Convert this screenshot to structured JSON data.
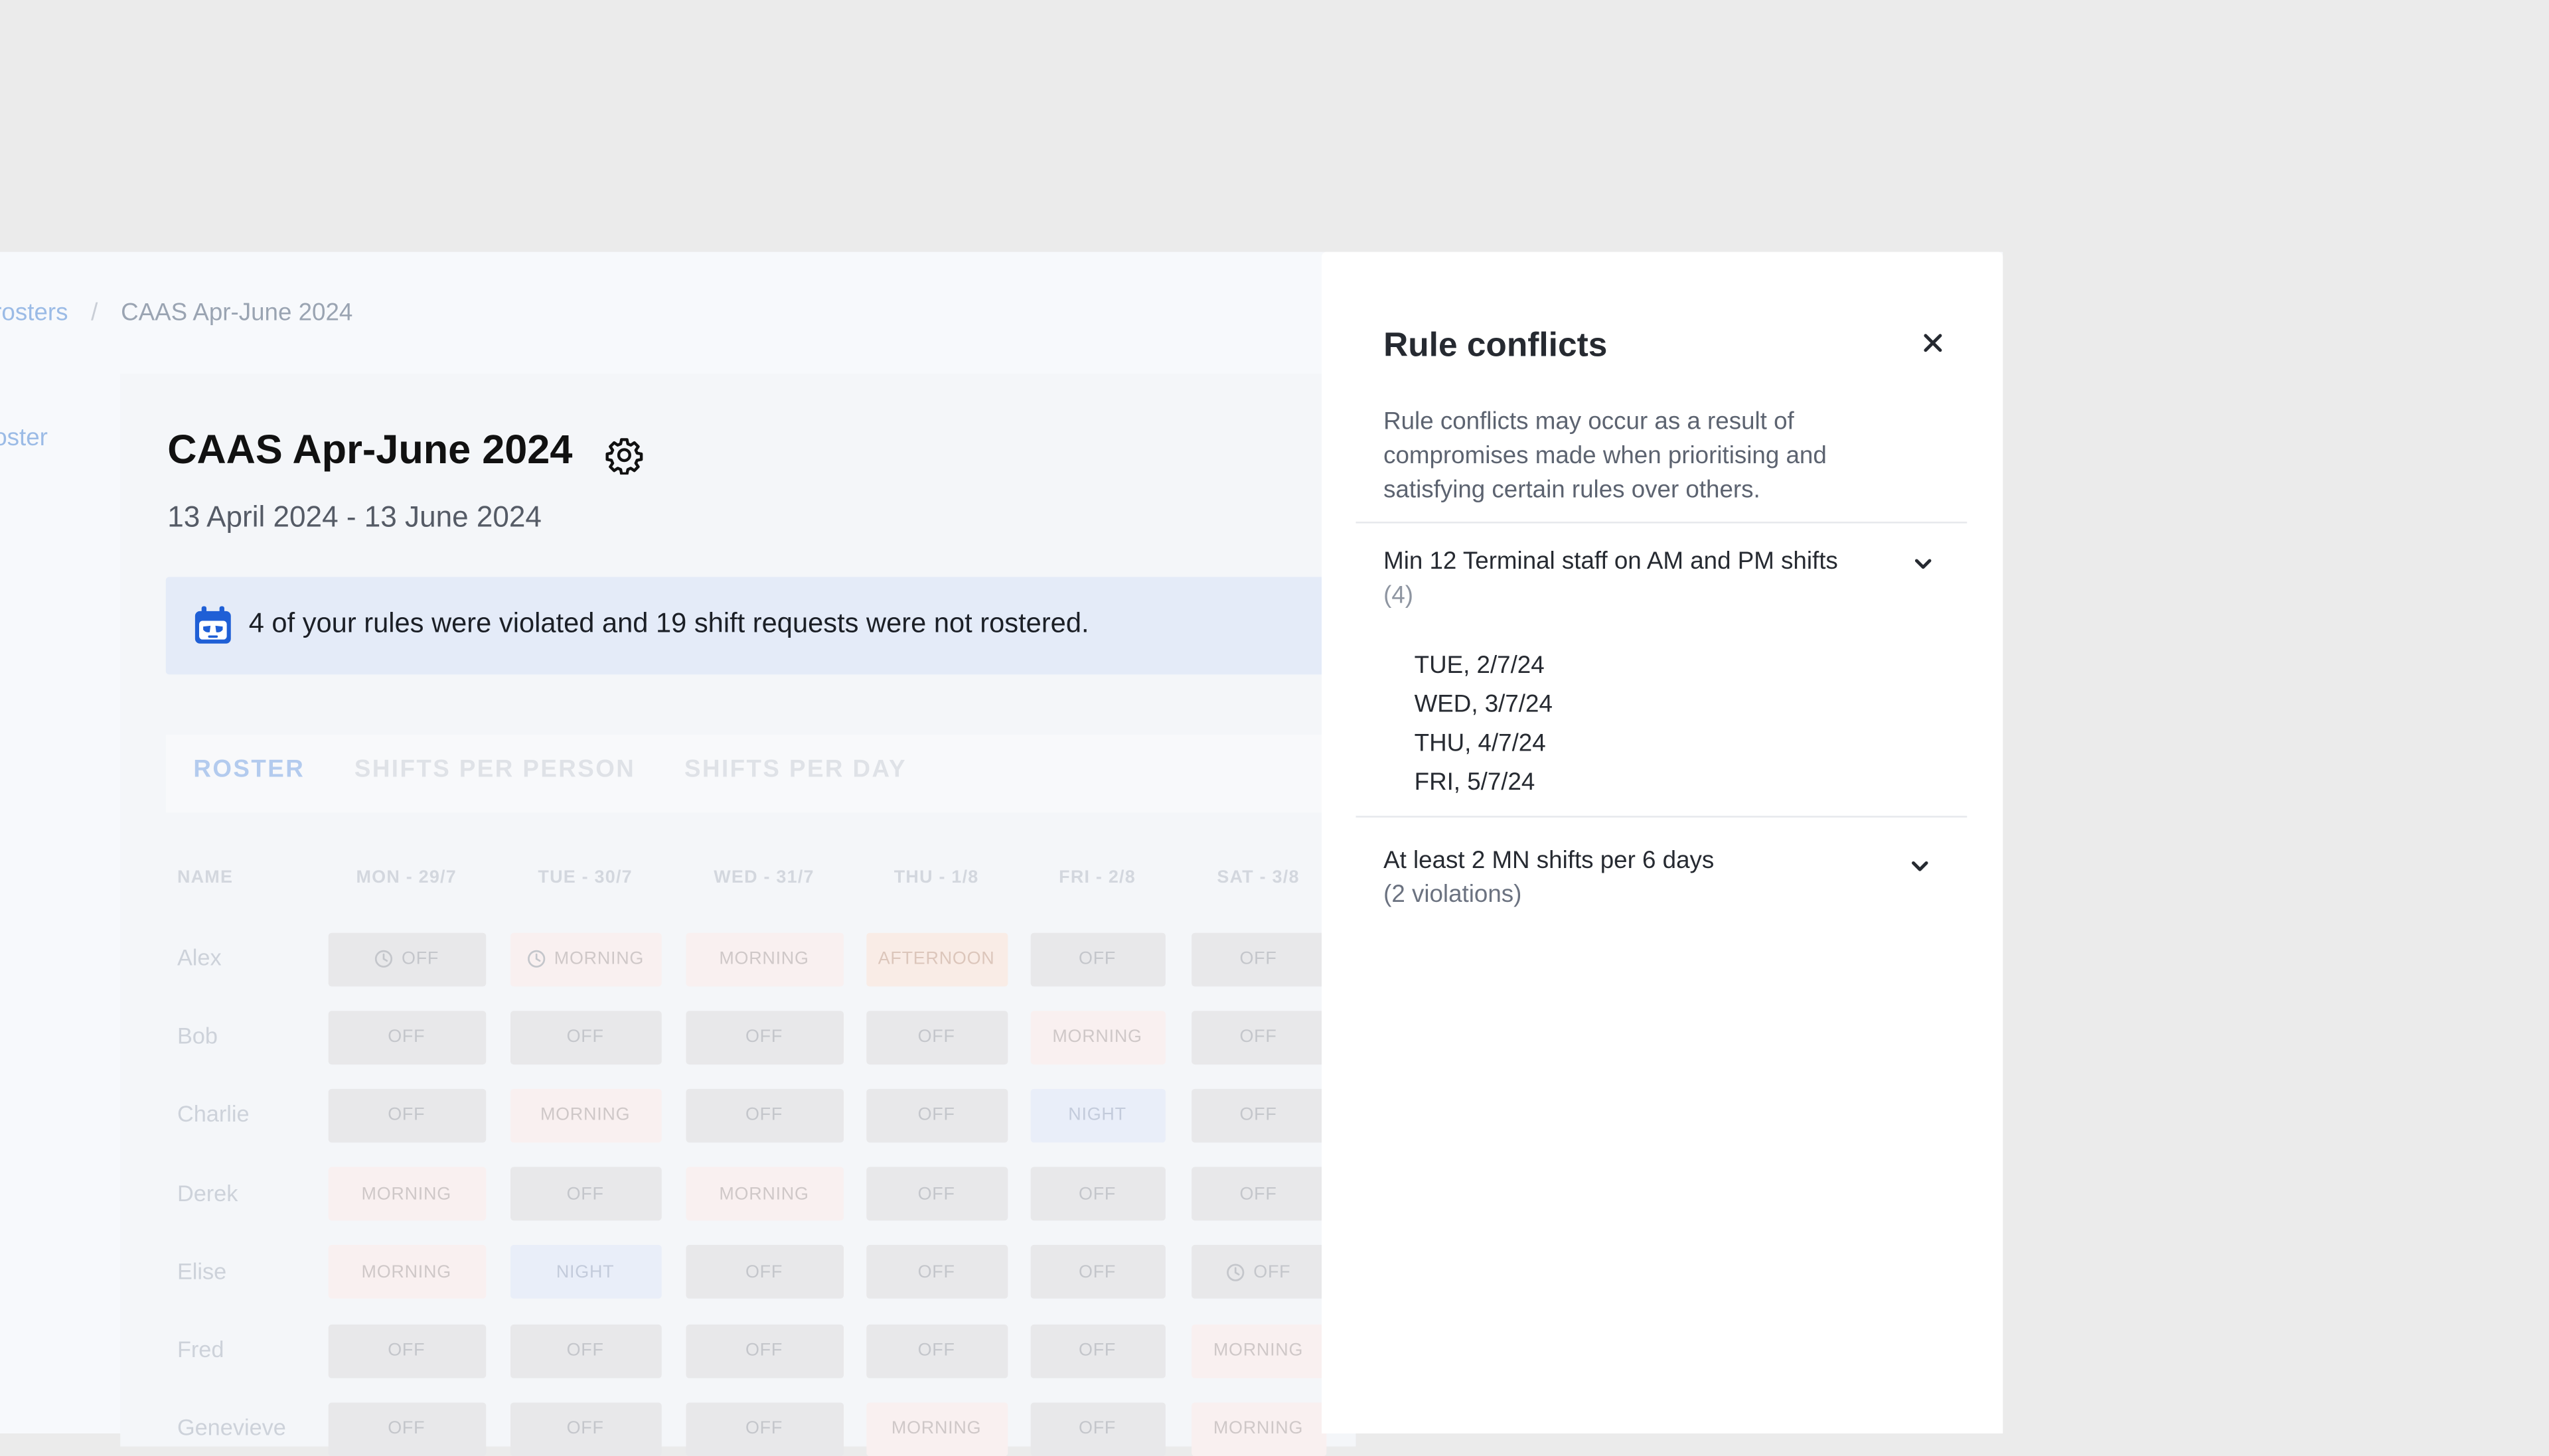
{
  "breadcrumb": {
    "parent": "rosters",
    "current": "CAAS Apr-June 2024"
  },
  "sidebar": {
    "link_label": "oster"
  },
  "roster": {
    "title": "CAAS Apr-June 2024",
    "date_range": "13 April 2024 - 13 June 2024",
    "banner_text": "4 of your rules were violated and 19 shift requests were not rostered."
  },
  "tabs": [
    {
      "label": "ROSTER",
      "active": true
    },
    {
      "label": "SHIFTS PER PERSON",
      "active": false
    },
    {
      "label": "SHIFTS PER DAY",
      "active": false
    }
  ],
  "table": {
    "headers": [
      "NAME",
      "MON - 29/7",
      "TUE - 30/7",
      "WED - 31/7",
      "THU - 1/8",
      "FRI - 2/8",
      "SAT - 3/8"
    ],
    "rows": [
      {
        "name": "Alex",
        "cells": [
          {
            "label": "OFF",
            "type": "off",
            "clock": true
          },
          {
            "label": "MORNING",
            "type": "morning",
            "clock": true
          },
          {
            "label": "MORNING",
            "type": "morning"
          },
          {
            "label": "AFTERNOON",
            "type": "afternoon"
          },
          {
            "label": "OFF",
            "type": "off"
          },
          {
            "label": "OFF",
            "type": "off"
          }
        ]
      },
      {
        "name": "Bob",
        "cells": [
          {
            "label": "OFF",
            "type": "off"
          },
          {
            "label": "OFF",
            "type": "off"
          },
          {
            "label": "OFF",
            "type": "off"
          },
          {
            "label": "OFF",
            "type": "off"
          },
          {
            "label": "MORNING",
            "type": "morning"
          },
          {
            "label": "OFF",
            "type": "off"
          }
        ]
      },
      {
        "name": "Charlie",
        "cells": [
          {
            "label": "OFF",
            "type": "off"
          },
          {
            "label": "MORNING",
            "type": "morning"
          },
          {
            "label": "OFF",
            "type": "off"
          },
          {
            "label": "OFF",
            "type": "off"
          },
          {
            "label": "NIGHT",
            "type": "night"
          },
          {
            "label": "OFF",
            "type": "off"
          }
        ]
      },
      {
        "name": "Derek",
        "cells": [
          {
            "label": "MORNING",
            "type": "morning"
          },
          {
            "label": "OFF",
            "type": "off"
          },
          {
            "label": "MORNING",
            "type": "morning"
          },
          {
            "label": "OFF",
            "type": "off"
          },
          {
            "label": "OFF",
            "type": "off"
          },
          {
            "label": "OFF",
            "type": "off"
          }
        ]
      },
      {
        "name": "Elise",
        "cells": [
          {
            "label": "MORNING",
            "type": "morning"
          },
          {
            "label": "NIGHT",
            "type": "night"
          },
          {
            "label": "OFF",
            "type": "off"
          },
          {
            "label": "OFF",
            "type": "off"
          },
          {
            "label": "OFF",
            "type": "off"
          },
          {
            "label": "OFF",
            "type": "off",
            "clock": true
          }
        ]
      },
      {
        "name": "Fred",
        "cells": [
          {
            "label": "OFF",
            "type": "off"
          },
          {
            "label": "OFF",
            "type": "off"
          },
          {
            "label": "OFF",
            "type": "off"
          },
          {
            "label": "OFF",
            "type": "off"
          },
          {
            "label": "OFF",
            "type": "off"
          },
          {
            "label": "MORNING",
            "type": "morning"
          }
        ]
      },
      {
        "name": "Genevieve",
        "cells": [
          {
            "label": "OFF",
            "type": "off"
          },
          {
            "label": "OFF",
            "type": "off"
          },
          {
            "label": "OFF",
            "type": "off"
          },
          {
            "label": "MORNING",
            "type": "morning"
          },
          {
            "label": "OFF",
            "type": "off"
          },
          {
            "label": "MORNING",
            "type": "morning"
          }
        ]
      }
    ]
  },
  "drawer": {
    "title": "Rule conflicts",
    "description": "Rule conflicts may occur as a result of compromises made when prioritising and satisfying certain rules over others.",
    "conflicts": [
      {
        "title": "Min 12 Terminal staff on AM and PM shifts",
        "subtitle": "(4)",
        "expanded": true,
        "dates": [
          "TUE, 2/7/24",
          "WED, 3/7/24",
          "THU, 4/7/24",
          "FRI, 5/7/24"
        ]
      },
      {
        "title": "At least 2 MN shifts per 6 days",
        "subtitle": "(2 violations)",
        "expanded": false,
        "dates": []
      }
    ]
  },
  "icons": {
    "settings": "gear-icon",
    "banner": "calendar-robot-icon",
    "close": "close-icon",
    "chevron": "chevron-down-icon",
    "clock": "clock-icon"
  },
  "colors": {
    "accent": "#1f5fd6",
    "banner_bg": "#e4ebf8",
    "overlay": "#ebebeb"
  }
}
